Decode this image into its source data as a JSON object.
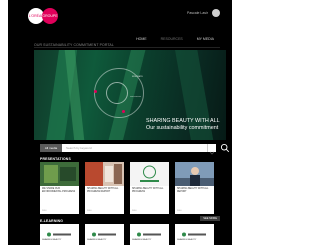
{
  "header": {
    "logo_left_text": "L'ORÉAL",
    "logo_right_text": "GROUPE",
    "user_name": "Pascale Lasir",
    "subtitle": "OUR SUSTAINABILITY COMMITMENT PORTAL",
    "nav": [
      {
        "label": "HOME",
        "active": false
      },
      {
        "label": "RESOURCES",
        "active": true
      },
      {
        "label": "MY MEDIA",
        "active": false
      }
    ]
  },
  "hero": {
    "title": "SHARING BEAUTY WITH ALL",
    "subtitle": "Our sustainability commitment",
    "label_1": "INNOVATE",
    "label_2": "PRODUCE"
  },
  "search": {
    "scope": "All media",
    "placeholder": "Search by keyword"
  },
  "sections": [
    {
      "label": "PRESENTATIONS",
      "see_more": "SEE MORE",
      "cards": [
        {
          "title": "WE SHARE OUR ENVIRONMENTAL PROGRESS",
          "meta": "2016"
        },
        {
          "title": "SHARING BEAUTY WITH ALL PROGRESS REPORT",
          "meta": "2016"
        },
        {
          "title": "SHARING BEAUTY WITH ALL PROGRESS",
          "meta": "2016"
        },
        {
          "title": "SHARING BEAUTY WITH ALL REPORT",
          "meta": "2016"
        }
      ]
    },
    {
      "label": "E-LEARNING",
      "cards": [
        {
          "title": "SHARING BEAUTY"
        },
        {
          "title": "SHARING BEAUTY"
        },
        {
          "title": "SHARING BEAUTY"
        },
        {
          "title": "SHARING BEAUTY"
        }
      ]
    }
  ],
  "colors": {
    "background": "#000000",
    "accent": "#e0005a",
    "hero_green": "#0f5a3b"
  }
}
